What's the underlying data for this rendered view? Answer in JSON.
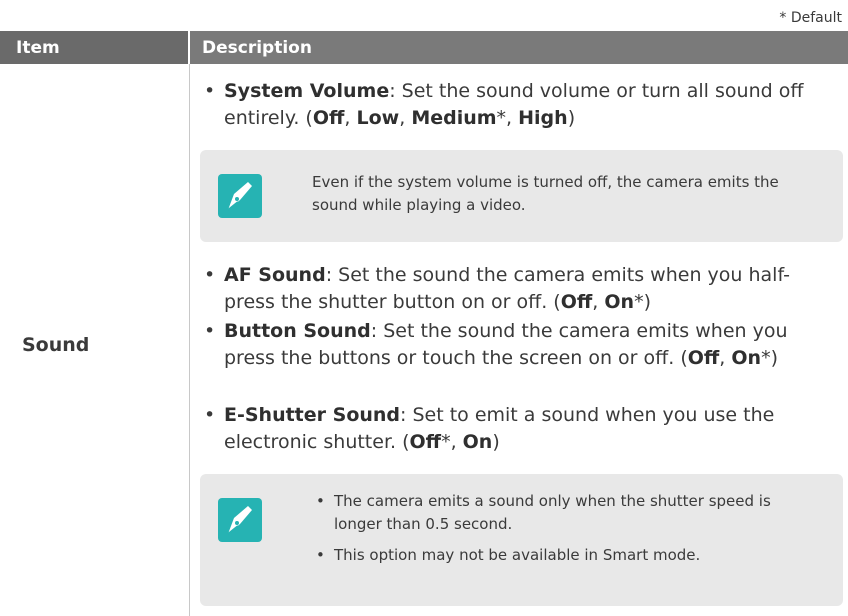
{
  "default_note": "* Default",
  "header": {
    "item": "Item",
    "description": "Description"
  },
  "row": {
    "item": "Sound",
    "bullets_top": [
      {
        "label": "System Volume",
        "text": ": Set the sound volume or turn all sound off entirely. (",
        "options": [
          {
            "value": "Off",
            "suffix": ", "
          },
          {
            "value": "Low",
            "suffix": ", "
          },
          {
            "value": "Medium",
            "suffix": "*, "
          },
          {
            "value": "High",
            "suffix": ""
          }
        ],
        "close": ")"
      }
    ],
    "note1": "Even if the system volume is turned off, the camera emits the sound while playing a video.",
    "bullets_bottom": [
      {
        "label": "AF Sound",
        "text": ": Set the sound the camera emits when you half-press the shutter button on or off. (",
        "options": [
          {
            "value": "Off",
            "suffix": ", "
          },
          {
            "value": "On",
            "suffix": "*"
          }
        ],
        "close": ")"
      },
      {
        "label": "Button Sound",
        "text": ": Set the sound the camera emits when you press the buttons or touch the screen on or off. (",
        "options": [
          {
            "value": "Off",
            "suffix": ", "
          },
          {
            "value": "On",
            "suffix": "*"
          }
        ],
        "close": ")"
      },
      {
        "label": "E-Shutter Sound",
        "text": ": Set to emit a sound when you use the electronic shutter. (",
        "options": [
          {
            "value": "Off",
            "suffix": "*, "
          },
          {
            "value": "On",
            "suffix": ""
          }
        ],
        "close": ")"
      }
    ],
    "note2": [
      "The camera emits a sound only when the shutter speed is longer than 0.5 second.",
      "This option may not be available in Smart mode."
    ]
  },
  "colors": {
    "header_bg": "#7a7a7a",
    "note_bg": "#e8e8e8",
    "icon_bg": "#26b3b3"
  },
  "icons": {
    "note": "pen-nib-icon"
  }
}
